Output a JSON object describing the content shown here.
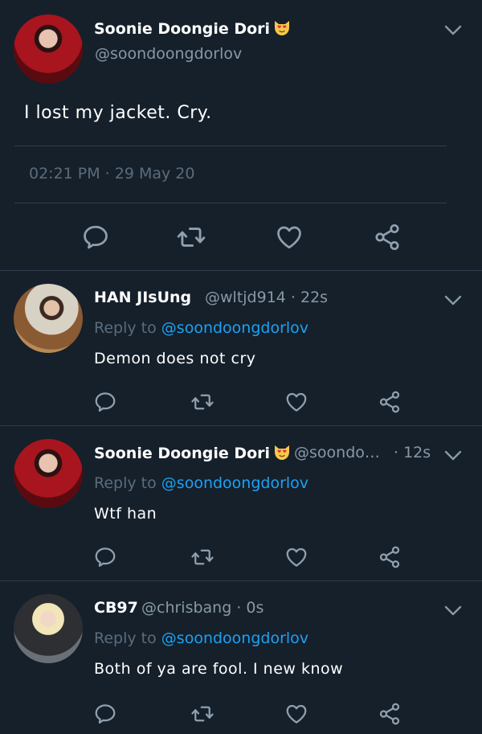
{
  "main_tweet": {
    "name": "Soonie Doongie Dori",
    "name_emoji": "smiling-cat-heart-eyes",
    "handle": "@soondoongdorlov",
    "text": "I lost my jacket. Cry.",
    "timestamp": "02:21 PM · 29 May 20"
  },
  "replies": [
    {
      "name": "HAN JIsUng",
      "handle_time": "@wltjd914 · 22s",
      "reply_to_label": "Reply to",
      "reply_to_handle": "@soondoongdorlov",
      "text": "Demon does not cry",
      "avatar": "guitar-player-avatar"
    },
    {
      "name": "Soonie Doongie Dori",
      "handle": "@soondo…",
      "time": "· 12s",
      "reply_to_label": "Reply to",
      "reply_to_handle": "@soondoongdorlov",
      "text": "Wtf han",
      "avatar": "red-outfit-avatar"
    },
    {
      "name": "CB97",
      "handle_time": "@chrisbang · 0s",
      "reply_to_label": "Reply to",
      "reply_to_handle": "@soondoongdorlov",
      "text": "Both of ya are fool. I new know",
      "avatar": "blond-avatar"
    }
  ],
  "icons": [
    "chevron-down-icon",
    "reply-icon",
    "retweet-icon",
    "like-icon",
    "share-icon"
  ],
  "colors": {
    "background": "#15202b",
    "accent": "#1da1f2",
    "muted": "#8899a6",
    "divider": "#2f3d4c"
  }
}
